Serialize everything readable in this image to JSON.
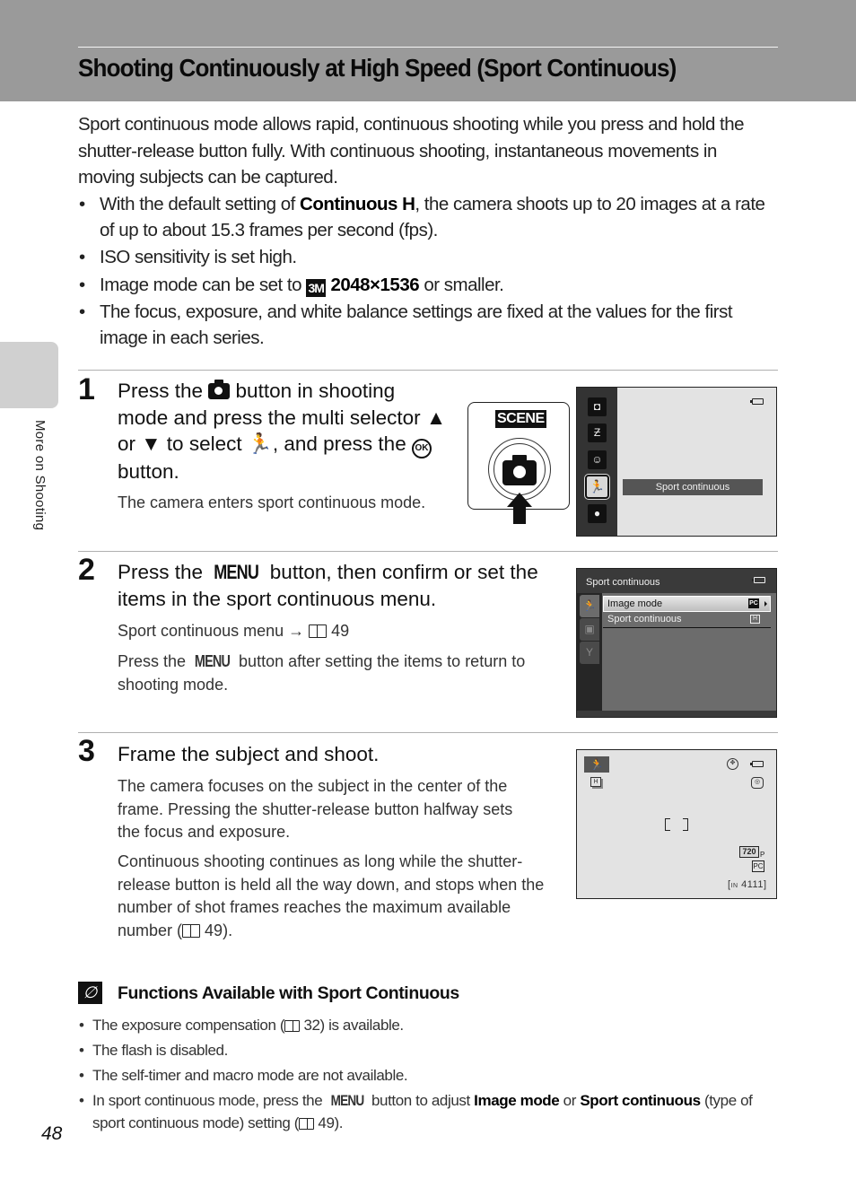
{
  "header": {
    "title": "Shooting Continuously at High Speed (Sport Continuous)"
  },
  "intro": "Sport continuous mode allows rapid, continuous shooting while you press and hold the shutter-release button fully. With continuous shooting, instantaneous movements in moving subjects can be captured.",
  "bullets": [
    {
      "pre": "With the default setting of ",
      "bold": "Continuous H",
      "post": ", the camera shoots up to 20 images at a rate of up to about 15.3 frames per second (fps)."
    },
    {
      "text": "ISO sensitivity is set high."
    },
    {
      "pre": "Image mode can be set to ",
      "icon": "3M",
      "bold": "2048×1536",
      "post": " or smaller."
    },
    {
      "text": "The focus, exposure, and white balance settings are fixed at the values for the first image in each series."
    }
  ],
  "steps": [
    {
      "number": "1",
      "title_parts": [
        "Press the ",
        " button in shooting mode and press the multi selector ",
        " or ",
        " to select ",
        ", and press the ",
        " button."
      ],
      "icons": {
        "camera": "camera-icon",
        "up": "▲",
        "down": "▼",
        "sport": "sport-continuous-icon",
        "ok": "OK"
      },
      "text": "The camera enters sport continuous mode.",
      "illustration": {
        "scene_label": "SCENE",
        "lcd": {
          "selected_label": "Sport continuous",
          "mode_icons": [
            "smart-portrait-icon",
            "scene-auto-icon",
            "smile-icon",
            "sport-continuous-icon",
            "auto-mode-icon"
          ],
          "selected_index": 3
        }
      }
    },
    {
      "number": "2",
      "title_pre": "Press the ",
      "title_menu": "MENU",
      "title_post": " button, then confirm or set the items in the sport continuous menu.",
      "ref_text": "Sport continuous menu → ",
      "ref_page": "49",
      "text_pre": "Press the ",
      "text_menu": "MENU",
      "text_post": " button after setting the items to return to shooting mode.",
      "lcd": {
        "header": "Sport continuous",
        "items": [
          {
            "label": "Image mode",
            "value": "PC"
          },
          {
            "label": "Sport continuous",
            "value": "H"
          }
        ]
      }
    },
    {
      "number": "3",
      "title": "Frame the subject and shoot.",
      "text1": "The camera focuses on the subject in the center of the frame. Pressing the shutter-release button halfway sets the focus and exposure.",
      "text2_pre": "Continuous shooting continues as long while the shutter-release button is held all the way down, and stops when the number of shot frames reaches the maximum available number (",
      "text2_page": "49",
      "text2_post": ").",
      "lcd": {
        "continuous_mode": "H",
        "movie_size": "720",
        "movie_suffix": "P",
        "image_mode": "PC",
        "shots_remaining": "4111",
        "memory_indicator": "IN"
      }
    }
  ],
  "note": {
    "title": "Functions Available with Sport Continuous",
    "items": [
      {
        "pre": "The exposure compensation (",
        "page": "32",
        "post": ") is available."
      },
      {
        "text": "The flash is disabled."
      },
      {
        "text": "The self-timer and macro mode are not available."
      },
      {
        "pre": "In sport continuous mode, press the ",
        "menu": "MENU",
        "mid": " button to adjust ",
        "bold1": "Image mode",
        "or": " or ",
        "bold2": "Sport continuous",
        "post2": " (type of sport continuous mode) setting (",
        "page": "49",
        "end": ")."
      }
    ]
  },
  "sidebar": {
    "section_label": "More on Shooting"
  },
  "footer": {
    "page_number": "48"
  }
}
